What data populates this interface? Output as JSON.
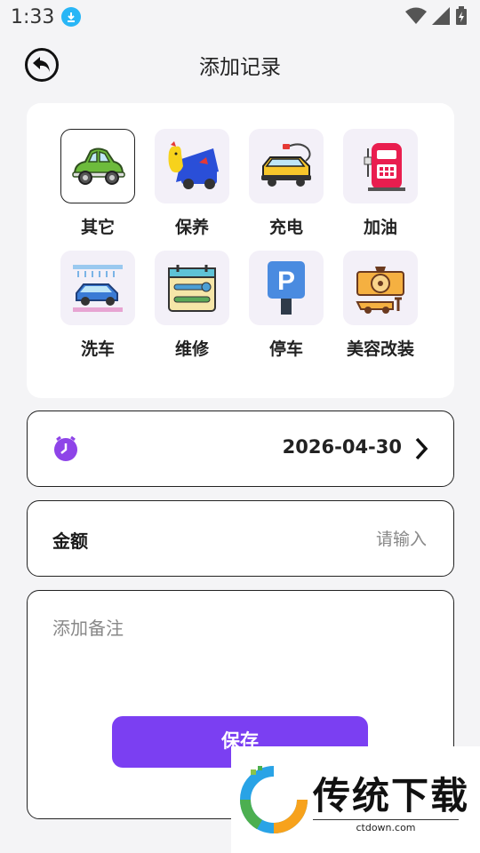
{
  "status_bar": {
    "time": "1:33"
  },
  "header": {
    "title": "添加记录"
  },
  "categories": [
    {
      "label": "其它",
      "icon": "car-icon",
      "selected": true
    },
    {
      "label": "保养",
      "icon": "maintenance-icon"
    },
    {
      "label": "充电",
      "icon": "ev-charge-icon"
    },
    {
      "label": "加油",
      "icon": "fuel-pump-icon"
    },
    {
      "label": "洗车",
      "icon": "car-wash-icon"
    },
    {
      "label": "维修",
      "icon": "repair-tools-icon"
    },
    {
      "label": "停车",
      "icon": "parking-sign-icon"
    },
    {
      "label": "美容改装",
      "icon": "car-modify-icon"
    }
  ],
  "date_row": {
    "value": "2026-04-30"
  },
  "amount_row": {
    "label": "金额",
    "placeholder": "请输入"
  },
  "note": {
    "placeholder": "添加备注"
  },
  "save_button": {
    "label": "保存"
  },
  "watermark": {
    "text": "传统下载",
    "url": "ctdown.com"
  },
  "colors": {
    "accent": "#7b3ff2",
    "background": "#f4f4f6"
  }
}
